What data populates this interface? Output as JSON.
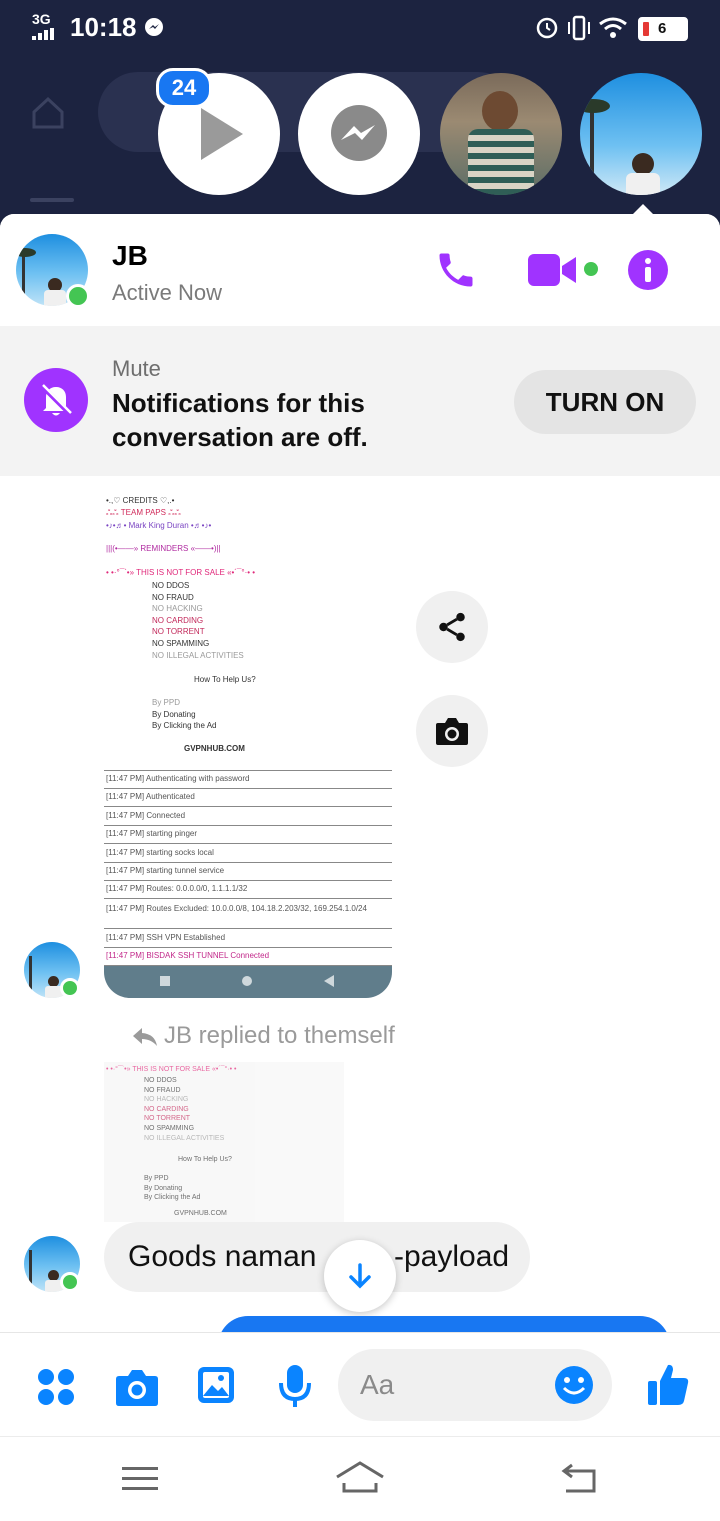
{
  "status_bar": {
    "network": "3G",
    "time": "10:18",
    "battery": "6"
  },
  "bubbles": {
    "badge_count": "24"
  },
  "header": {
    "name": "JB",
    "presence": "Active Now"
  },
  "mute": {
    "title": "Mute",
    "message_line1": "Notifications for this",
    "message_line2": "conversation are off.",
    "button": "TURN ON"
  },
  "shared_screenshot": {
    "credits": "•.,♡ CREDITS ♡,.•",
    "team": "ஃஃ TEAM PAPS ஃஃ",
    "author": "•♪•♬• Mark King Duran •♬•♪•",
    "reminders": "|||(•——» REMINDERS «——•)||",
    "not_for_sale": "• •·°¯`•» THIS IS NOT FOR SALE «•´¯°·• •",
    "rules": [
      "NO DDOS",
      "NO FRAUD",
      "NO HACKING",
      "NO CARDING",
      "NO TORRENT",
      "NO SPAMMING",
      "NO ILLEGAL ACTIVITIES"
    ],
    "help_title": "How To Help Us?",
    "help_items": [
      "By PPD",
      "By Donating",
      "By Clicking the Ad"
    ],
    "site": "GVPNHUB.COM",
    "logs": [
      "[11:47 PM] Authenticating with password",
      "[11:47 PM] Authenticated",
      "[11:47 PM] Connected",
      "[11:47 PM] starting pinger",
      "[11:47 PM] starting socks local",
      "[11:47 PM] starting tunnel service",
      "[11:47 PM] Routes: 0.0.0.0/0, 1.1.1.1/32",
      "[11:47 PM] Routes Excluded: 10.0.0.0/8, 104.18.2.203/32, 169.254.1.0/24",
      "[11:47 PM] SSH VPN Established",
      "[11:47 PM] BISDAK SSH TUNNEL Connected"
    ]
  },
  "reply_note": "JB replied to themself",
  "last_message": {
    "text_left": "Goods naman",
    "text_right": "-payload"
  },
  "composer": {
    "placeholder": "Aa"
  },
  "colors": {
    "accent_purple": "#a033ff",
    "messenger_blue": "#0a84ff",
    "online_green": "#44c553"
  }
}
